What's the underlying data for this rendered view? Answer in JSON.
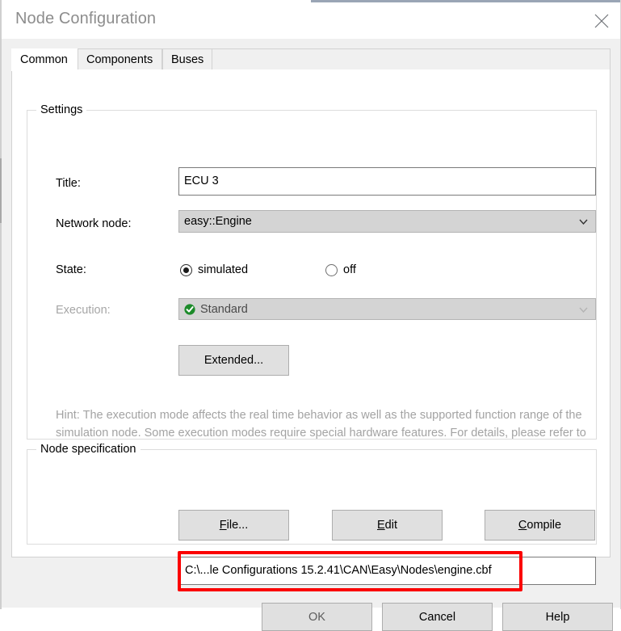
{
  "window": {
    "title": "Node Configuration",
    "close_icon": "close-icon",
    "accent_color": "#9aa5b5"
  },
  "tabs": [
    {
      "label": "Common",
      "active": true
    },
    {
      "label": "Components",
      "active": false
    },
    {
      "label": "Buses",
      "active": false
    }
  ],
  "settings": {
    "group_title": "Settings",
    "title_label": "Title:",
    "title_value": "ECU 3",
    "title_placeholder": "",
    "network_node_label": "Network node:",
    "network_node_value": "easy::Engine",
    "state_label": "State:",
    "state_options": [
      {
        "label": "simulated",
        "selected": true
      },
      {
        "label": "off",
        "selected": false
      }
    ],
    "execution_label": "Execution:",
    "execution_value": "Standard",
    "execution_badge": "green-check-icon",
    "execution_disabled": true,
    "extended_button": "Extended...",
    "hint": "Hint: The execution mode affects the real time behavior as well as the supported function range of the simulation node. Some execution modes require special hardware features. For details, please refer to the online help."
  },
  "node_specification": {
    "group_title": "Node specification",
    "file_button": {
      "mnemonic": "F",
      "rest": "ile..."
    },
    "edit_button": {
      "mnemonic": "E",
      "rest": "dit"
    },
    "compile_button": {
      "mnemonic": "C",
      "rest": "ompile"
    },
    "path_value": "C:\\...le Configurations 15.2.41\\CAN\\Easy\\Nodes\\engine.cbf",
    "path_placeholder": "",
    "highlight_color": "#fb0000"
  },
  "footer": {
    "ok_label": "OK",
    "cancel_label": "Cancel",
    "help_label": "Help"
  }
}
